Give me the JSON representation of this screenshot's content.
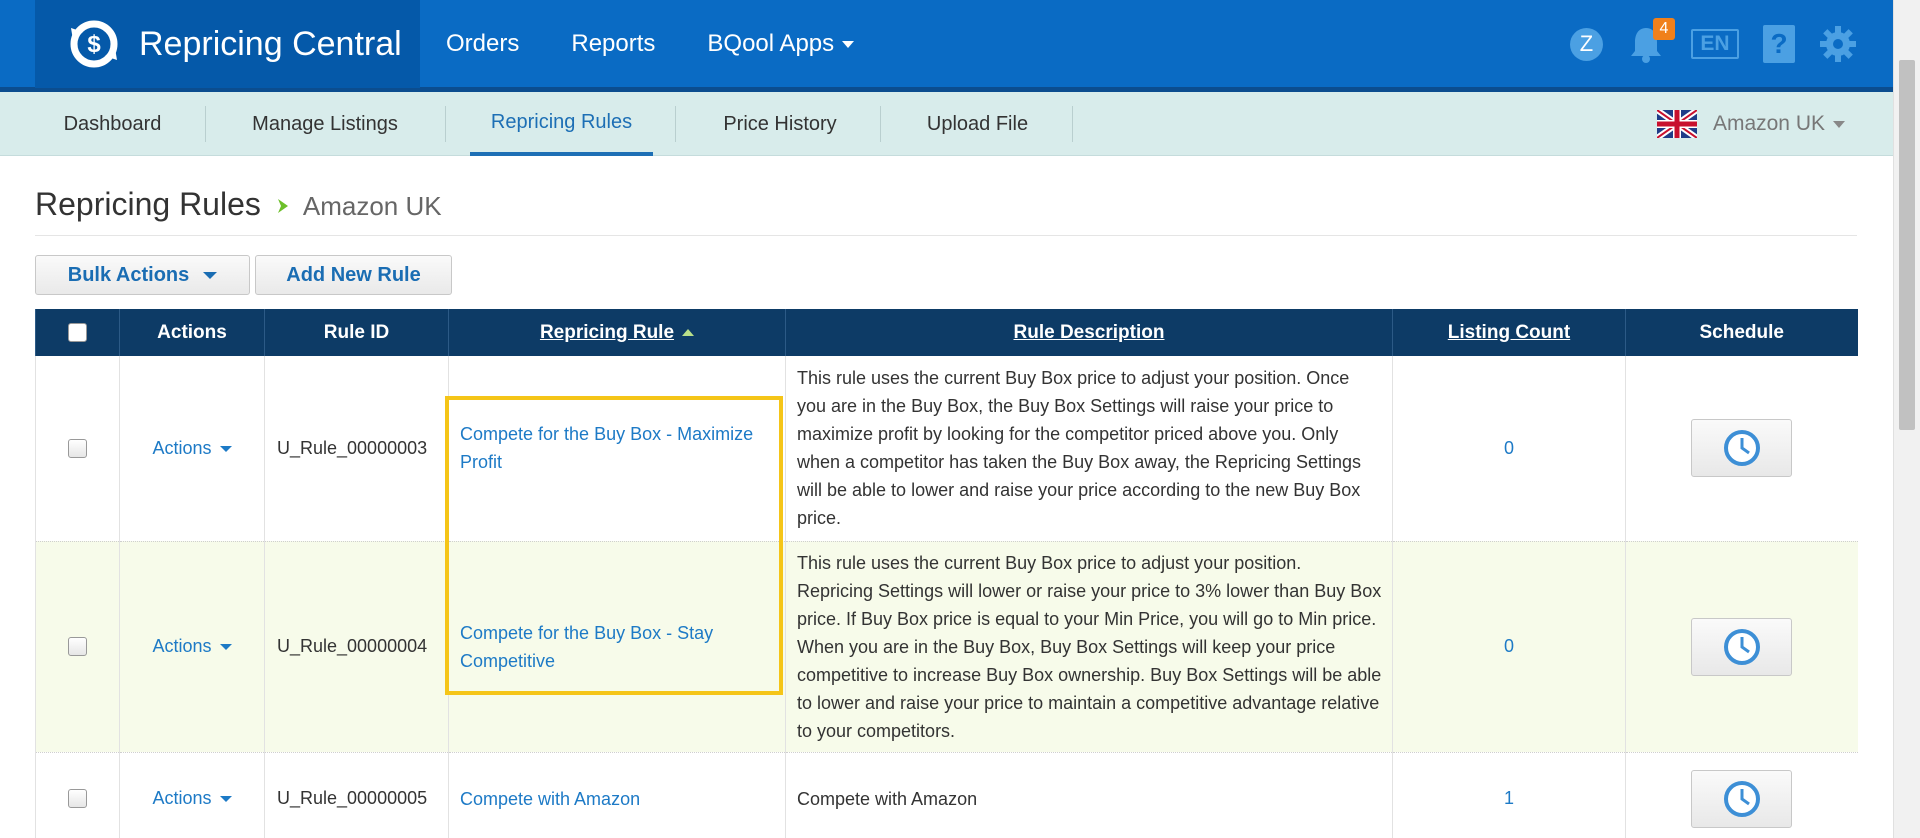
{
  "app": {
    "title": "Repricing Central",
    "nav": [
      "Orders",
      "Reports",
      "BQool Apps"
    ],
    "user_initial": "Z",
    "notification_count": "4",
    "language": "EN",
    "help_label": "?"
  },
  "subnav": {
    "tabs": [
      "Dashboard",
      "Manage Listings",
      "Repricing Rules",
      "Price History",
      "Upload File"
    ],
    "active_tab": "Repricing Rules",
    "marketplace": "Amazon UK"
  },
  "page": {
    "title": "Repricing Rules",
    "crumb": "Amazon UK"
  },
  "toolbar": {
    "bulk_actions": "Bulk Actions",
    "add_rule": "Add New Rule"
  },
  "table": {
    "headers": {
      "actions": "Actions",
      "rule_id": "Rule ID",
      "repricing_rule": "Repricing Rule",
      "rule_description": "Rule Description",
      "listing_count": "Listing Count",
      "schedule": "Schedule"
    },
    "sort_column": "Repricing Rule",
    "sort_direction": "ascending",
    "rows": [
      {
        "actions": "Actions",
        "rule_id": "U_Rule_00000003",
        "rule": "Compete for the Buy Box - Maximize Profit",
        "description": "This rule uses the current Buy Box price to adjust your position. Once you are in the Buy Box, the Buy Box Settings will raise your price to maximize profit by looking for the competitor priced above you. Only when a competitor has taken the Buy Box away, the Repricing Settings will be able to lower and raise your price according to the new Buy Box price.",
        "count": "0"
      },
      {
        "actions": "Actions",
        "rule_id": "U_Rule_00000004",
        "rule": "Compete for the Buy Box - Stay Competitive",
        "description": "This rule uses the current Buy Box price to adjust your position. Repricing Settings will lower or raise your price to 3% lower than Buy Box price. If Buy Box price is equal to your Min Price, you will go to Min price. When you are in the Buy Box, Buy Box Settings will keep your price competitive to increase Buy Box ownership. Buy Box Settings will be able to lower and raise your price to maintain a competitive advantage relative to your competitors.",
        "count": "0"
      },
      {
        "actions": "Actions",
        "rule_id": "U_Rule_00000005",
        "rule": "Compete with Amazon",
        "description": "Compete with Amazon",
        "count": "1"
      }
    ]
  },
  "colors": {
    "topbar": "#0a6bc4",
    "brand_bg": "#0559a9",
    "subnav": "#d8eceb",
    "table_header": "#0d3b66",
    "link": "#1d7ac6",
    "highlight": "#f5c518"
  }
}
